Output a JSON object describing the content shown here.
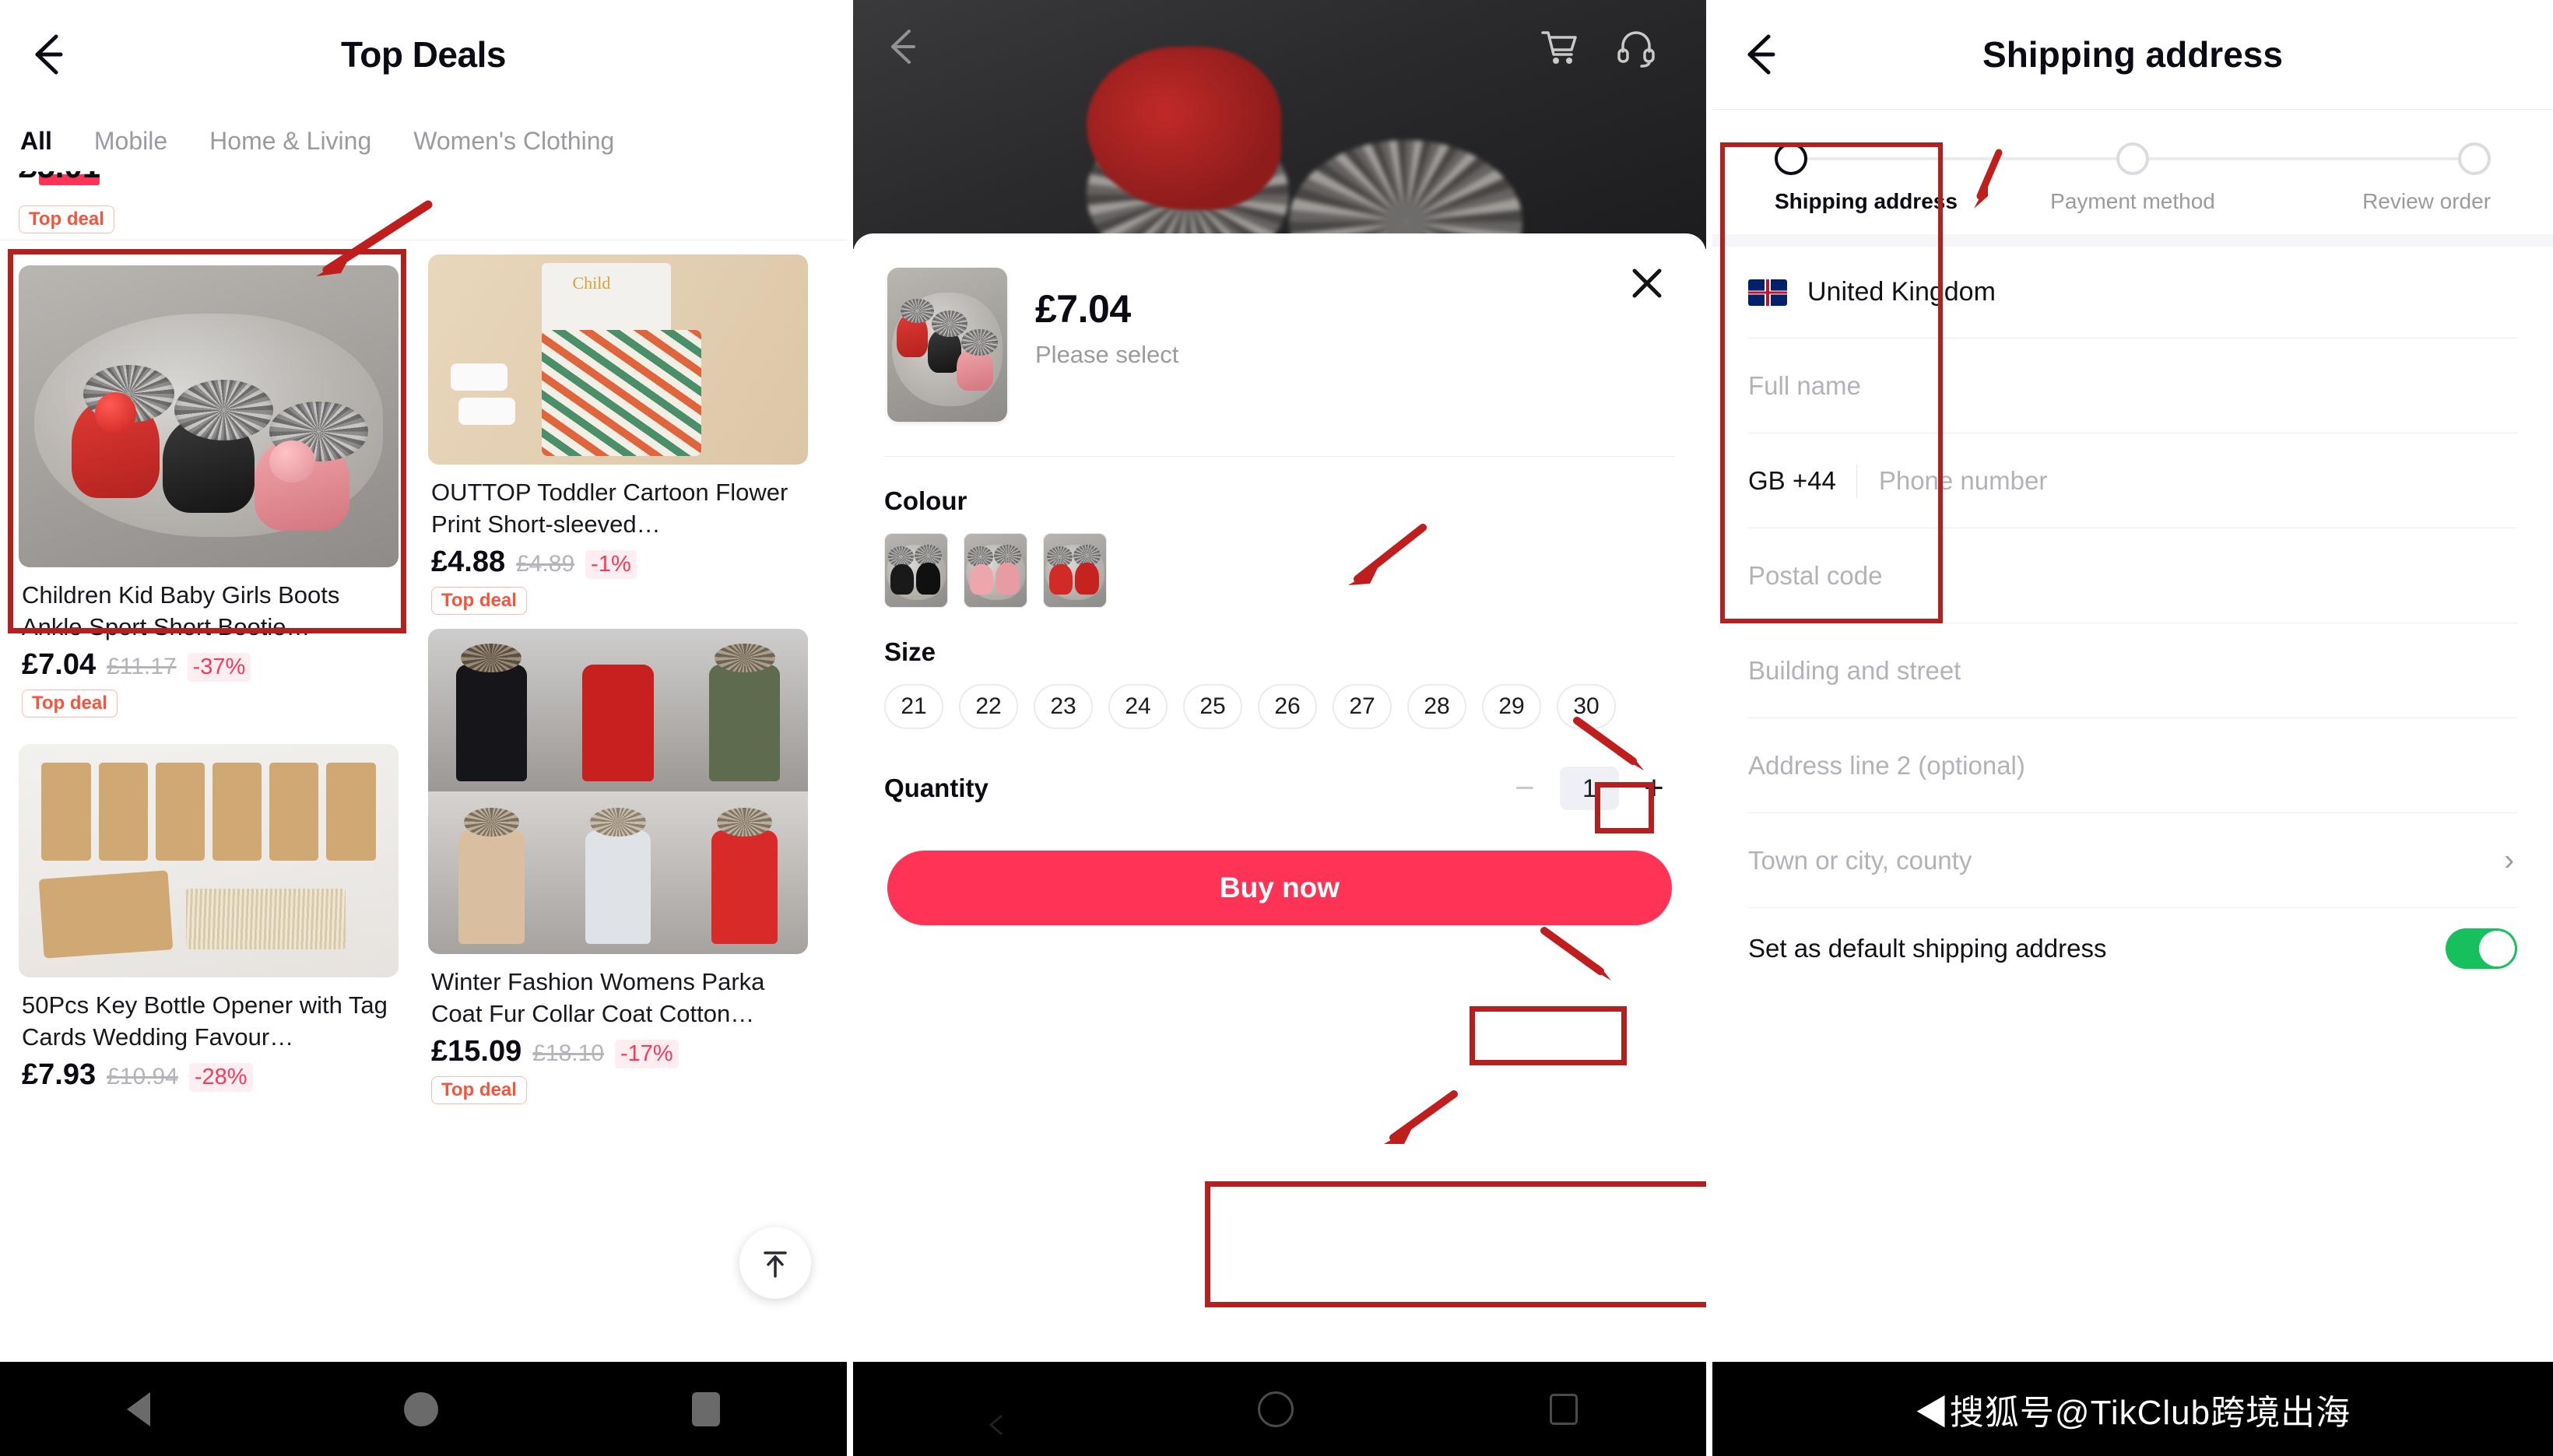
{
  "left_panel": {
    "header": {
      "back_icon": "back-arrow-icon",
      "title": "Top Deals"
    },
    "tabs": [
      {
        "label": "All",
        "active": true
      },
      {
        "label": "Mobile",
        "active": false
      },
      {
        "label": "Home & Living",
        "active": false
      },
      {
        "label": "Women's Clothing",
        "active": false
      }
    ],
    "partial_card_badge": "Top deal",
    "products": [
      {
        "title": "Children Kid Baby Girls Boots Ankle Sport Short Bootie…",
        "price": "£7.04",
        "original_price": "£11.17",
        "discount": "-37%",
        "badge": "Top deal",
        "image": "kids-fur-boots-trio",
        "highlighted": true
      },
      {
        "title": "OUTTOP Toddler Cartoon Flower Print Short-sleeved…",
        "price": "£4.88",
        "original_price": "£4.89",
        "discount": "-1%",
        "badge": "Top deal",
        "image": "toddler-flower-print-outfit",
        "highlighted": false
      },
      {
        "title": "50Pcs Key Bottle Opener with Tag Cards Wedding Favour…",
        "price": "£7.93",
        "original_price": "£10.94",
        "discount": "-28%",
        "badge": "",
        "image": "key-bottle-openers-tags",
        "highlighted": false
      },
      {
        "title": "Winter Fashion Womens Parka Coat Fur Collar Coat Cotton…",
        "price": "£15.09",
        "original_price": "£18.10",
        "discount": "-17%",
        "badge": "Top deal",
        "image": "womens-parka-coats-grid",
        "highlighted": false
      }
    ],
    "scroll_top_icon": "scroll-to-top-icon",
    "navbar": {
      "back": "nav-back-icon",
      "home": "nav-home-icon",
      "recents": "nav-recents-icon"
    }
  },
  "middle_panel": {
    "hero": {
      "back_icon": "back-arrow-icon",
      "cart_icon": "shopping-cart-icon",
      "support_icon": "customer-support-headset-icon"
    },
    "sheet": {
      "thumbnail": "kids-fur-boots-trio",
      "price": "£7.04",
      "select_hint": "Please select",
      "close_icon": "close-icon",
      "colour_label": "Colour",
      "colours": [
        {
          "name": "black",
          "selected": true
        },
        {
          "name": "pink",
          "selected": false
        },
        {
          "name": "red",
          "selected": false
        }
      ],
      "size_label": "Size",
      "sizes": [
        "21",
        "22",
        "23",
        "24",
        "25",
        "26",
        "27",
        "28",
        "29",
        "30"
      ],
      "highlighted_size": "28",
      "quantity_label": "Quantity",
      "quantity_value": "1",
      "quantity_minus": "−",
      "quantity_plus": "+",
      "buy_label": "Buy now"
    },
    "navbar": {
      "back": "nav-back-icon",
      "home": "nav-home-icon",
      "recents": "nav-recents-icon"
    }
  },
  "right_panel": {
    "header": {
      "back_icon": "back-arrow-icon",
      "title": "Shipping address"
    },
    "steps": [
      {
        "label": "Shipping address",
        "active": true
      },
      {
        "label": "Payment method",
        "active": false
      },
      {
        "label": "Review order",
        "active": false
      }
    ],
    "form": {
      "country": {
        "name": "United Kingdom",
        "flag": "uk-flag-icon"
      },
      "full_name_placeholder": "Full name",
      "dial_code": "GB +44",
      "phone_placeholder": "Phone number",
      "postal_placeholder": "Postal code",
      "building_placeholder": "Building and street",
      "address2_placeholder": "Address line 2 (optional)",
      "town_placeholder": "Town or city, county",
      "town_chevron": "chevron-right-icon"
    },
    "default_address": {
      "label": "Set as default shipping address",
      "enabled": true
    },
    "watermark": "◀搜狐号@TikClub跨境出海"
  },
  "theme": {
    "accent_red": "#ff3355",
    "annotation_red": "#b32020",
    "arrow_red": "#c01d1d",
    "badge_red": "#f4553c",
    "toggle_green": "#16c05c",
    "text_dark": "#0b0b14",
    "text_muted": "#9a9aa3"
  }
}
